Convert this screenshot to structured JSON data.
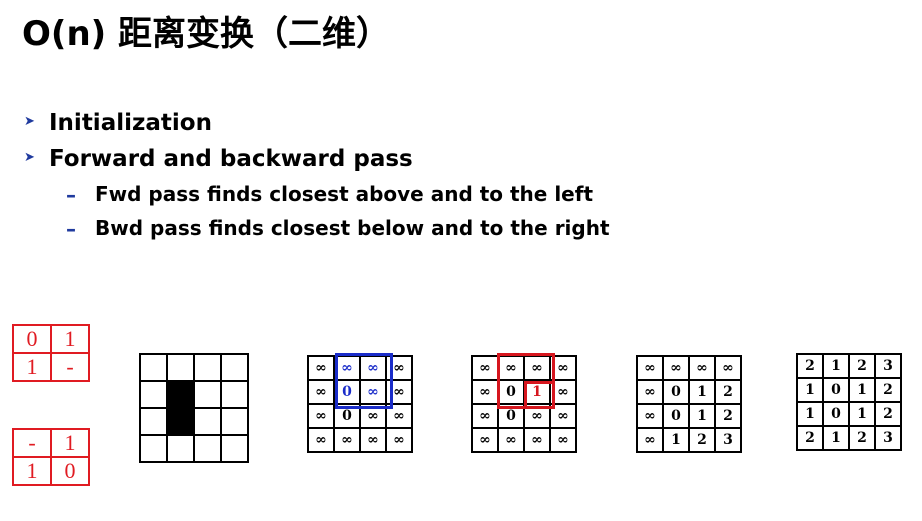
{
  "slide": {
    "title": "O(n) 距离变换（二维）",
    "bullets": [
      {
        "text": "Initialization"
      },
      {
        "text": "Forward and backward pass"
      }
    ],
    "sub_bullets": [
      {
        "text": "Fwd pass finds closest above and to the left"
      },
      {
        "text": "Bwd pass finds closest below and to the right"
      }
    ],
    "arrow_glyph": "➤",
    "dash_glyph": "–"
  },
  "kernels": {
    "forward": [
      [
        "0",
        "1"
      ],
      [
        "1",
        "-"
      ]
    ],
    "backward": [
      [
        "-",
        "1"
      ],
      [
        "1",
        "0"
      ]
    ],
    "color": "#e01b22"
  },
  "grids": {
    "binary": [
      [
        0,
        0,
        0,
        0
      ],
      [
        0,
        1,
        0,
        0
      ],
      [
        0,
        1,
        0,
        0
      ],
      [
        0,
        0,
        0,
        0
      ]
    ],
    "init": [
      [
        "∞",
        "∞",
        "∞",
        "∞"
      ],
      [
        "∞",
        "0",
        "∞",
        "∞"
      ],
      [
        "∞",
        "0",
        "∞",
        "∞"
      ],
      [
        "∞",
        "∞",
        "∞",
        "∞"
      ]
    ],
    "fwd_step": [
      [
        "∞",
        "∞",
        "∞",
        "∞"
      ],
      [
        "∞",
        "0",
        "1",
        "∞"
      ],
      [
        "∞",
        "0",
        "∞",
        "∞"
      ],
      [
        "∞",
        "∞",
        "∞",
        "∞"
      ]
    ],
    "fwd_result": [
      [
        "∞",
        "∞",
        "∞",
        "∞"
      ],
      [
        "∞",
        "0",
        "1",
        "2"
      ],
      [
        "∞",
        "0",
        "1",
        "2"
      ],
      [
        "∞",
        "1",
        "2",
        "3"
      ]
    ],
    "bwd_result": [
      [
        "2",
        "1",
        "2",
        "3"
      ],
      [
        "1",
        "0",
        "1",
        "2"
      ],
      [
        "1",
        "0",
        "1",
        "2"
      ],
      [
        "2",
        "1",
        "2",
        "3"
      ]
    ]
  },
  "highlight_colors": {
    "blue": "#1a2cc9",
    "red": "#d6161e"
  }
}
